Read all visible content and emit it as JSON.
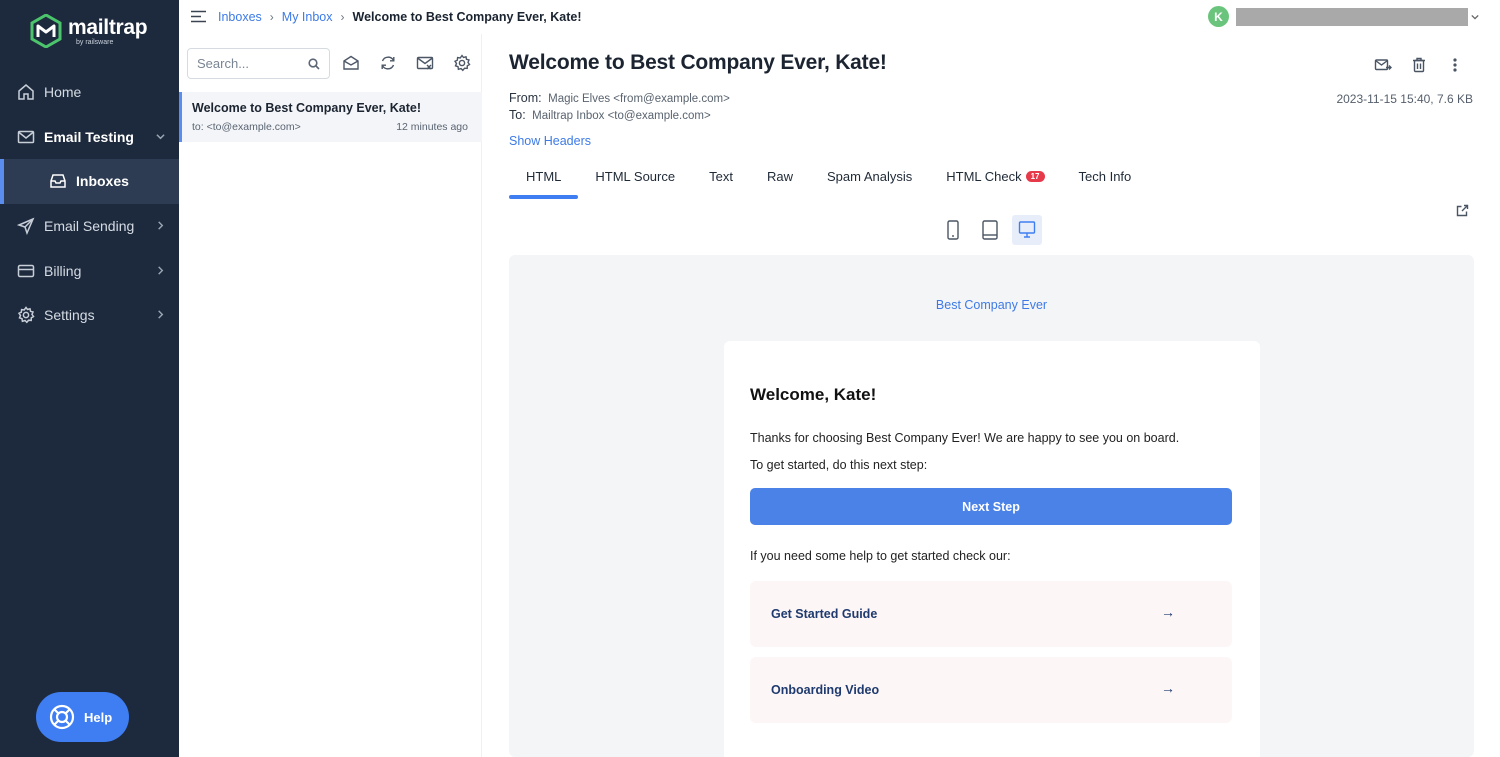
{
  "brand": {
    "name": "mailtrap",
    "sub": "by railsware",
    "green": "#4cc46b"
  },
  "sidebar": {
    "items": [
      {
        "label": "Home"
      },
      {
        "label": "Email Testing"
      },
      {
        "label": "Inboxes"
      },
      {
        "label": "Email Sending"
      },
      {
        "label": "Billing"
      },
      {
        "label": "Settings"
      }
    ],
    "help_label": "Help"
  },
  "topbar": {
    "breadcrumb": [
      "Inboxes",
      "My Inbox",
      "Welcome to Best Company Ever, Kate!"
    ],
    "avatar_initial": "K"
  },
  "list": {
    "search_placeholder": "Search...",
    "messages": [
      {
        "subject": "Welcome to Best Company Ever, Kate!",
        "to": "to: <to@example.com>",
        "time": "12 minutes ago"
      }
    ]
  },
  "message": {
    "subject": "Welcome to Best Company Ever, Kate!",
    "from_label": "From:",
    "from_value": "Magic Elves <from@example.com>",
    "to_label": "To:",
    "to_value": "Mailtrap Inbox <to@example.com>",
    "meta": "2023-11-15 15:40, 7.6 KB",
    "show_headers": "Show Headers",
    "tabs": [
      {
        "label": "HTML"
      },
      {
        "label": "HTML Source"
      },
      {
        "label": "Text"
      },
      {
        "label": "Raw"
      },
      {
        "label": "Spam Analysis"
      },
      {
        "label": "HTML Check",
        "badge": "17"
      },
      {
        "label": "Tech Info"
      }
    ]
  },
  "preview": {
    "brand": "Best Company Ever",
    "heading": "Welcome, Kate!",
    "p1": "Thanks for choosing Best Company Ever! We are happy to see you on board.",
    "p2": "To get started, do this next step:",
    "button": "Next Step",
    "p3": "If you need some help to get started check our:",
    "links": [
      {
        "label": "Get Started Guide",
        "arrow": "→"
      },
      {
        "label": "Onboarding Video",
        "arrow": "→"
      }
    ]
  }
}
